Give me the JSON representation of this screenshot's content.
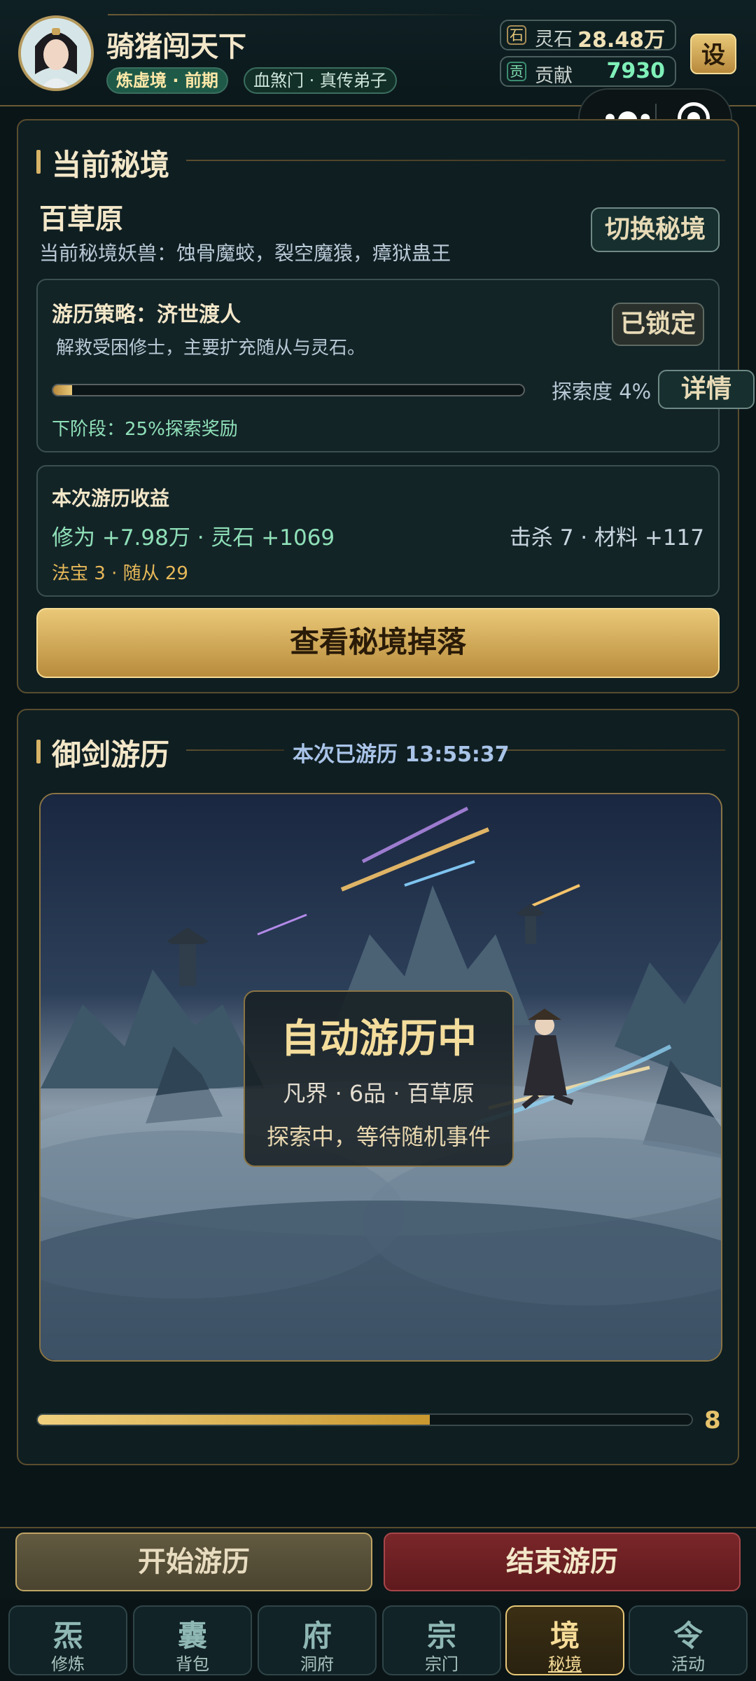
{
  "header": {
    "player_name": "骑猪闯天下",
    "realm_tag": "炼虚境 · 前期",
    "sect_tag": "血煞门 · 真传弟子",
    "spirit_stone": {
      "icon": "石",
      "label": "灵石",
      "value": "28.48万"
    },
    "contribution": {
      "icon": "贡",
      "label": "贡献",
      "value": "7930"
    },
    "settings_label": "设"
  },
  "realm_panel": {
    "title": "当前秘境",
    "realm_name": "百草原",
    "beasts": "当前秘境妖兽：蚀骨魔蛟，裂空魔猿，瘴狱蛊王",
    "switch_label": "切换秘境",
    "strategy": {
      "title": "游历策略：济世渡人",
      "desc": "解救受困修士，主要扩充随从与灵石。",
      "locked_label": "已锁定",
      "explore_text": "探索度 4%",
      "explore_fraction": 0.04,
      "detail_label": "详情",
      "next_stage": "下阶段：25%探索奖励"
    },
    "gain": {
      "title": "本次游历收益",
      "left": "修为 +7.98万 · 灵石 +1069",
      "right": "击杀 7 · 材料 +117",
      "third": "法宝 3 · 随从 29"
    },
    "drops_label": "查看秘境掉落"
  },
  "travel_panel": {
    "title": "御剑游历",
    "elapsed": "本次已游历 13:55:37",
    "overlay_title": "自动游历中",
    "overlay_line1": "凡界 · 6品 · 百草原",
    "overlay_line2": "探索中，等待随机事件",
    "progress_fraction": 0.6,
    "progress_number": "8"
  },
  "actions": {
    "start_label": "开始游历",
    "end_label": "结束游历"
  },
  "tabs": [
    {
      "glyph": "炁",
      "label": "修炼"
    },
    {
      "glyph": "囊",
      "label": "背包"
    },
    {
      "glyph": "府",
      "label": "洞府"
    },
    {
      "glyph": "宗",
      "label": "宗门"
    },
    {
      "glyph": "境",
      "label": "秘境"
    },
    {
      "glyph": "令",
      "label": "活动"
    }
  ],
  "colors": {
    "accent_gold": "#e8c878",
    "mint": "#8fe0b8",
    "danger": "#7a2629"
  }
}
